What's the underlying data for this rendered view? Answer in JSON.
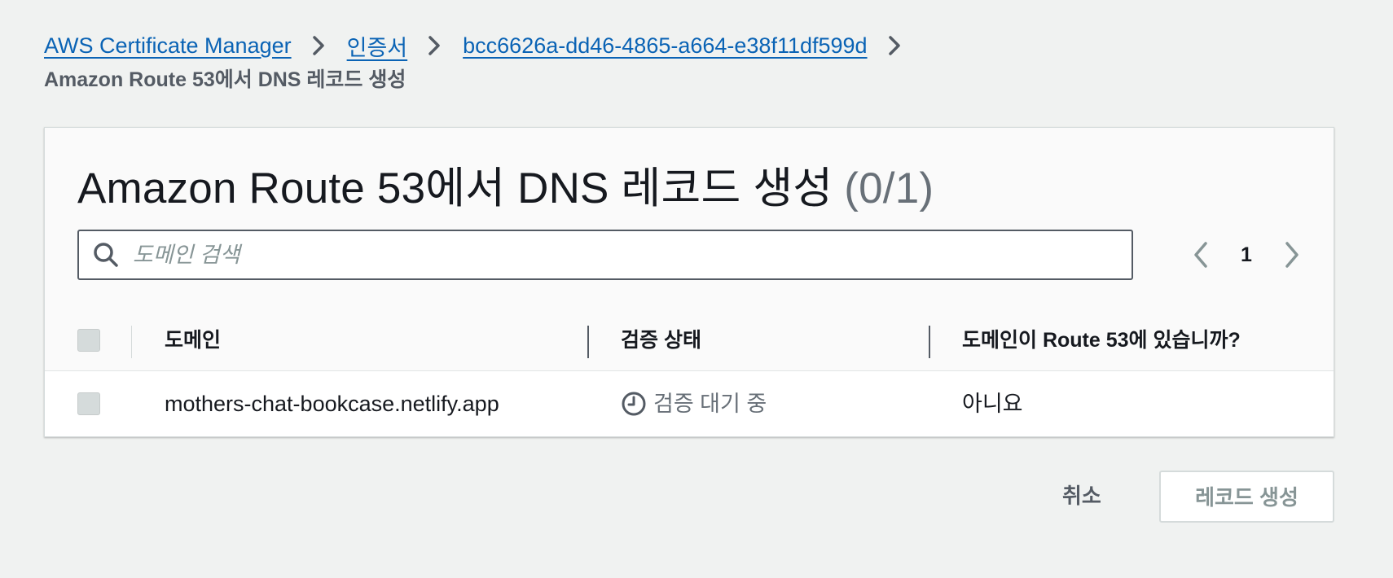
{
  "breadcrumb": {
    "items": [
      {
        "label": "AWS Certificate Manager"
      },
      {
        "label": "인증서"
      },
      {
        "label": "bcc6626a-dd46-4865-a664-e38f11df599d"
      }
    ],
    "current": "Amazon Route 53에서 DNS 레코드 생성"
  },
  "panel": {
    "title": "Amazon Route 53에서 DNS 레코드 생성",
    "count": "(0/1)",
    "search": {
      "placeholder": "도메인 검색",
      "value": ""
    },
    "pagination": {
      "current_page": "1"
    }
  },
  "table": {
    "columns": [
      "도메인",
      "검증 상태",
      "도메인이 Route 53에 있습니까?"
    ],
    "rows": [
      {
        "domain": "mothers-chat-bookcase.netlify.app",
        "status": "검증 대기 중",
        "in_route53": "아니요"
      }
    ]
  },
  "footer": {
    "cancel_label": "취소",
    "create_label": "레코드 생성"
  },
  "colors": {
    "link": "#0a63b5",
    "background": "#f0f2f1",
    "disabled_text": "#879596",
    "pending_status": "#687078"
  },
  "icons": {
    "breadcrumb_separator": "chevron-right-icon",
    "search": "search-icon",
    "prev_page": "chevron-left-icon",
    "next_page": "chevron-right-icon",
    "status_pending": "clock-icon"
  }
}
